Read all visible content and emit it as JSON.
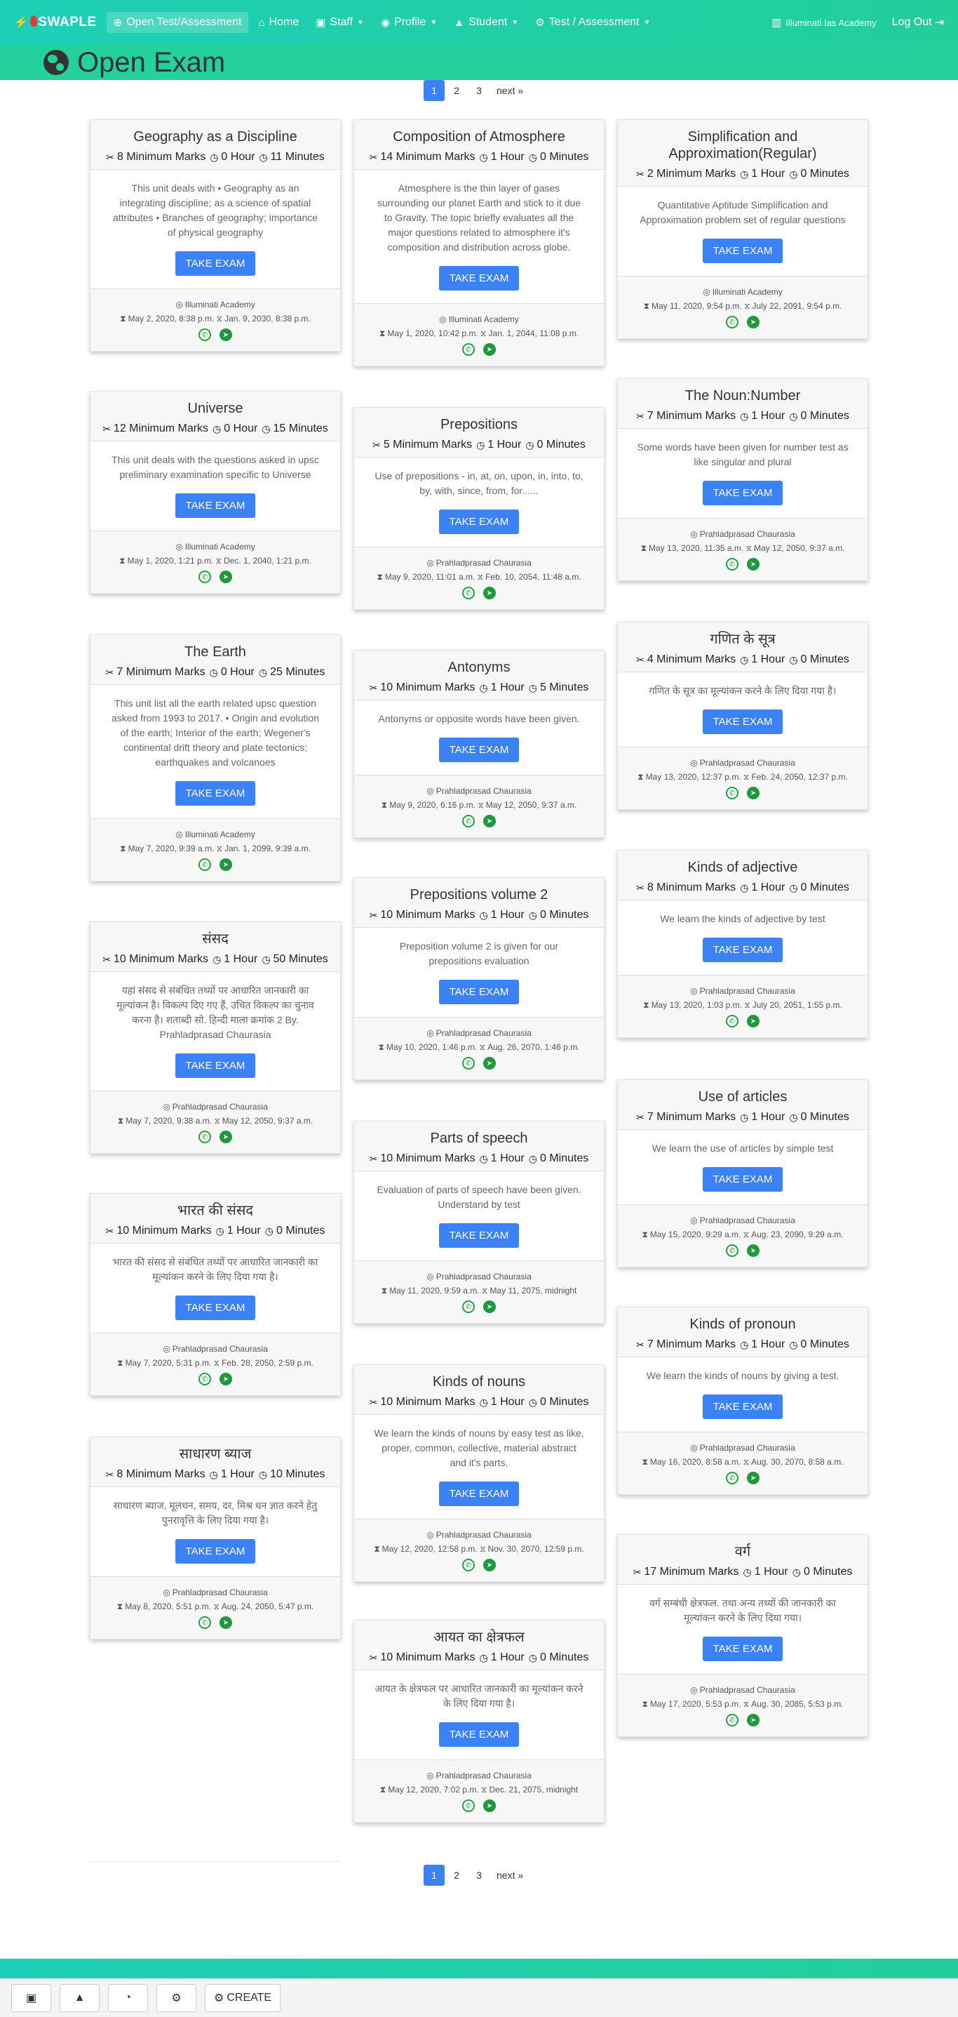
{
  "navbar": {
    "brand": "SWAPLE",
    "items": [
      {
        "label": "Open Test/Assessment",
        "icon": "globe-icon",
        "glyph": "⊕",
        "dropdown": false,
        "active": true
      },
      {
        "label": "Home",
        "icon": "home-icon",
        "glyph": "⌂",
        "dropdown": false,
        "active": false
      },
      {
        "label": "Staff",
        "icon": "staff-icon",
        "glyph": "▣",
        "dropdown": true,
        "active": false
      },
      {
        "label": "Profile",
        "icon": "profile-icon",
        "glyph": "◉",
        "dropdown": true,
        "active": false
      },
      {
        "label": "Student",
        "icon": "student-icon",
        "glyph": "▲",
        "dropdown": true,
        "active": false
      },
      {
        "label": "Test / Assessment",
        "icon": "test-icon",
        "glyph": "⚙",
        "dropdown": true,
        "active": false
      }
    ],
    "academy": "Illuminati Ias Academy",
    "logout": "Log Out"
  },
  "page": {
    "title": "Open Exam"
  },
  "pagination": {
    "pages": [
      "1",
      "2",
      "3"
    ],
    "active": "1",
    "next": "next »"
  },
  "exam_button_label": "TAKE EXAM",
  "cards": [
    {
      "title": "Geography as a Discipline",
      "marks": "8 Minimum Marks",
      "hours": "0 Hour",
      "minutes": "11 Minutes",
      "description": "This unit deals with • Geography as an integrating discipline; as a science of spatial attributes • Branches of geography; importance of physical geography",
      "author": "Illuminati Academy",
      "start": "May 2, 2020, 8:38 p.m.",
      "end": "Jan. 9, 2030, 8:38 p.m."
    },
    {
      "title": "Universe",
      "marks": "12 Minimum Marks",
      "hours": "0 Hour",
      "minutes": "15 Minutes",
      "description": "This unit deals with the questions asked in upsc preliminary examination specific to Universe",
      "author": "Illuminati Academy",
      "start": "May 1, 2020, 1:21 p.m.",
      "end": "Dec. 1, 2040, 1:21 p.m."
    },
    {
      "title": "The Earth",
      "marks": "7 Minimum Marks",
      "hours": "0 Hour",
      "minutes": "25 Minutes",
      "description": "This unit list all the earth related upsc question asked from 1993 to 2017. • Origin and evolution of the earth; Interior of the earth; Wegener's continental drift theory and plate tectonics; earthquakes and volcanoes",
      "author": "Illuminati Academy",
      "start": "May 7, 2020, 9:39 a.m.",
      "end": "Jan. 1, 2099, 9:39 a.m."
    },
    {
      "title": "संसद",
      "marks": "10 Minimum Marks",
      "hours": "1 Hour",
      "minutes": "50 Minutes",
      "description": "यहां संसद से संबंधित तथ्यों पर आधारित जानकारी का मूल्यांकन है। विकल्प दिए गए हैं, उचित विकल्प का चुनाव करना है। शताब्दी सो. हिन्दी माला क्रमांक 2 By. Prahladprasad Chaurasia",
      "author": "Prahladprasad Chaurasia",
      "start": "May 7, 2020, 9:38 a.m.",
      "end": "May 12, 2050, 9:37 a.m."
    },
    {
      "title": "भारत की संसद",
      "marks": "10 Minimum Marks",
      "hours": "1 Hour",
      "minutes": "0 Minutes",
      "description": "भारत की संसद से संबंधित तथ्यों पर आधारित जानकारी का मूल्यांकन करने के लिए दिया गया है।",
      "author": "Prahladprasad Chaurasia",
      "start": "May 7, 2020, 5:31 p.m.",
      "end": "Feb. 28, 2050, 2:59 p.m."
    },
    {
      "title": "साधारण ब्याज",
      "marks": "8 Minimum Marks",
      "hours": "1 Hour",
      "minutes": "10 Minutes",
      "description": "साधारण ब्याज, मूलधन, समय, दर, मिश्र धन ज्ञात करने हेतु पुनरावृत्ति के लिए दिया गया है।",
      "author": "Prahladprasad Chaurasia",
      "start": "May 8, 2020, 5:51 p.m.",
      "end": "Aug. 24, 2050, 5:47 p.m."
    },
    {
      "title": "Composition of Atmosphere",
      "marks": "14 Minimum Marks",
      "hours": "1 Hour",
      "minutes": "0 Minutes",
      "description": "Atmosphere is the thin layer of gases surrounding our planet Earth and stick to it due to Gravity. The topic briefly evaluates all the major questions related to atmosphere it's composition and distribution across globe.",
      "author": "Illuminati Academy",
      "start": "May 1, 2020, 10:42 p.m.",
      "end": "Jan. 1, 2044, 11:08 p.m."
    },
    {
      "title": "Prepositions",
      "marks": "5 Minimum Marks",
      "hours": "1 Hour",
      "minutes": "0 Minutes",
      "description": "Use of prepositions - in, at, on, upon, in, into, to, by, with, since, from, for......",
      "author": "Prahladprasad Chaurasia",
      "start": "May 9, 2020, 11:01 a.m.",
      "end": "Feb. 10, 2054, 11:48 a.m."
    },
    {
      "title": "Antonyms",
      "marks": "10 Minimum Marks",
      "hours": "1 Hour",
      "minutes": "5 Minutes",
      "description": "Antonyms or opposite words have been given.",
      "author": "Prahladprasad Chaurasia",
      "start": "May 9, 2020, 6:16 p.m.",
      "end": "May 12, 2050, 9:37 a.m."
    },
    {
      "title": "Prepositions volume 2",
      "marks": "10 Minimum Marks",
      "hours": "1 Hour",
      "minutes": "0 Minutes",
      "description": "Preposition volume 2 is given for our prepositions evaluation",
      "author": "Prahladprasad Chaurasia",
      "start": "May 10, 2020, 1:46 p.m.",
      "end": "Aug. 26, 2070, 1:46 p.m."
    },
    {
      "title": "Parts of speech",
      "marks": "10 Minimum Marks",
      "hours": "1 Hour",
      "minutes": "0 Minutes",
      "description": "Evaluation of parts of speech have been given. Understand by test",
      "author": "Prahladprasad Chaurasia",
      "start": "May 11, 2020, 9:59 a.m.",
      "end": "May 11, 2075, midnight"
    },
    {
      "title": "Kinds of nouns",
      "marks": "10 Minimum Marks",
      "hours": "1 Hour",
      "minutes": "0 Minutes",
      "description": "We learn the kinds of nouns by easy test as like, proper, common, collective, material abstract and it's parts.",
      "author": "Prahladprasad Chaurasia",
      "start": "May 12, 2020, 12:58 p.m.",
      "end": "Nov. 30, 2070, 12:59 p.m."
    },
    {
      "title": "आयत का क्षेत्रफल",
      "marks": "10 Minimum Marks",
      "hours": "1 Hour",
      "minutes": "0 Minutes",
      "description": "आयत के क्षेत्रफल पर आधारित जानकारी का मूल्यांकन करने के लिए दिया गया है।",
      "author": "Prahladprasad Chaurasia",
      "start": "May 12, 2020, 7:02 p.m.",
      "end": "Dec. 21, 2075, midnight"
    },
    {
      "title": "Simplification and Approximation(Regular)",
      "marks": "2 Minimum Marks",
      "hours": "1 Hour",
      "minutes": "0 Minutes",
      "description": "Quantitative Aptitude Simplification and Approximation problem set of regular questions",
      "author": "Illuminati Academy",
      "start": "May 11, 2020, 9:54 p.m.",
      "end": "July 22, 2091, 9:54 p.m."
    },
    {
      "title": "The Noun:Number",
      "marks": "7 Minimum Marks",
      "hours": "1 Hour",
      "minutes": "0 Minutes",
      "description": "Some words have been given for number test as like singular and plural",
      "author": "Prahladprasad Chaurasia",
      "start": "May 13, 2020, 11:35 a.m.",
      "end": "May 12, 2050, 9:37 a.m."
    },
    {
      "title": "गणित के सूत्र",
      "marks": "4 Minimum Marks",
      "hours": "1 Hour",
      "minutes": "0 Minutes",
      "description": "गणित के सूत्र का मूल्यांकन करने के लिए दिया गया है।",
      "author": "Prahladprasad Chaurasia",
      "start": "May 13, 2020, 12:37 p.m.",
      "end": "Feb. 24, 2050, 12:37 p.m."
    },
    {
      "title": "Kinds of adjective",
      "marks": "8 Minimum Marks",
      "hours": "1 Hour",
      "minutes": "0 Minutes",
      "description": "We learn the kinds of adjective by test",
      "author": "Prahladprasad Chaurasia",
      "start": "May 13, 2020, 1:03 p.m.",
      "end": "July 20, 2051, 1:55 p.m."
    },
    {
      "title": "Use of articles",
      "marks": "7 Minimum Marks",
      "hours": "1 Hour",
      "minutes": "0 Minutes",
      "description": "We learn the use of articles by simple test",
      "author": "Prahladprasad Chaurasia",
      "start": "May 15, 2020, 9:29 a.m.",
      "end": "Aug. 23, 2090, 9:29 a.m."
    },
    {
      "title": "Kinds of pronoun",
      "marks": "7 Minimum Marks",
      "hours": "1 Hour",
      "minutes": "0 Minutes",
      "description": "We learn the kinds of nouns by giving a test.",
      "author": "Prahladprasad Chaurasia",
      "start": "May 16, 2020, 8:58 a.m.",
      "end": "Aug. 30, 2070, 8:58 a.m."
    },
    {
      "title": "वर्ग",
      "marks": "17 Minimum Marks",
      "hours": "1 Hour",
      "minutes": "0 Minutes",
      "description": "वर्ग सम्बंधी क्षेत्रफल. तथा अन्य तथ्यों की जानकारी का मूल्यांकन करने के लिए दिया गया।",
      "author": "Prahladprasad Chaurasia",
      "start": "May 17, 2020, 5:53 p.m.",
      "end": "Aug. 30, 2085, 5:53 p.m."
    }
  ],
  "bottom_bar": {
    "buttons": [
      {
        "name": "open-test-icon-button",
        "icon": "test-icon",
        "glyph": "▣",
        "label": ""
      },
      {
        "name": "student-icon-button",
        "icon": "student-icon",
        "glyph": "▲",
        "label": ""
      },
      {
        "name": "dashboard-icon-button",
        "icon": "dashboard-icon",
        "glyph": "◔",
        "label": ""
      },
      {
        "name": "assessment-icon-button",
        "icon": "assessment-icon",
        "glyph": "⚙",
        "label": ""
      },
      {
        "name": "create-button",
        "icon": "create-icon",
        "glyph": "⚙",
        "label": "CREATE"
      }
    ]
  },
  "colors": {
    "navbar": "#1dcfb6",
    "header": "#24d19a",
    "button": "#3b82f6",
    "whatsapp": "#25a244",
    "telegram": "#1d9a3c"
  }
}
